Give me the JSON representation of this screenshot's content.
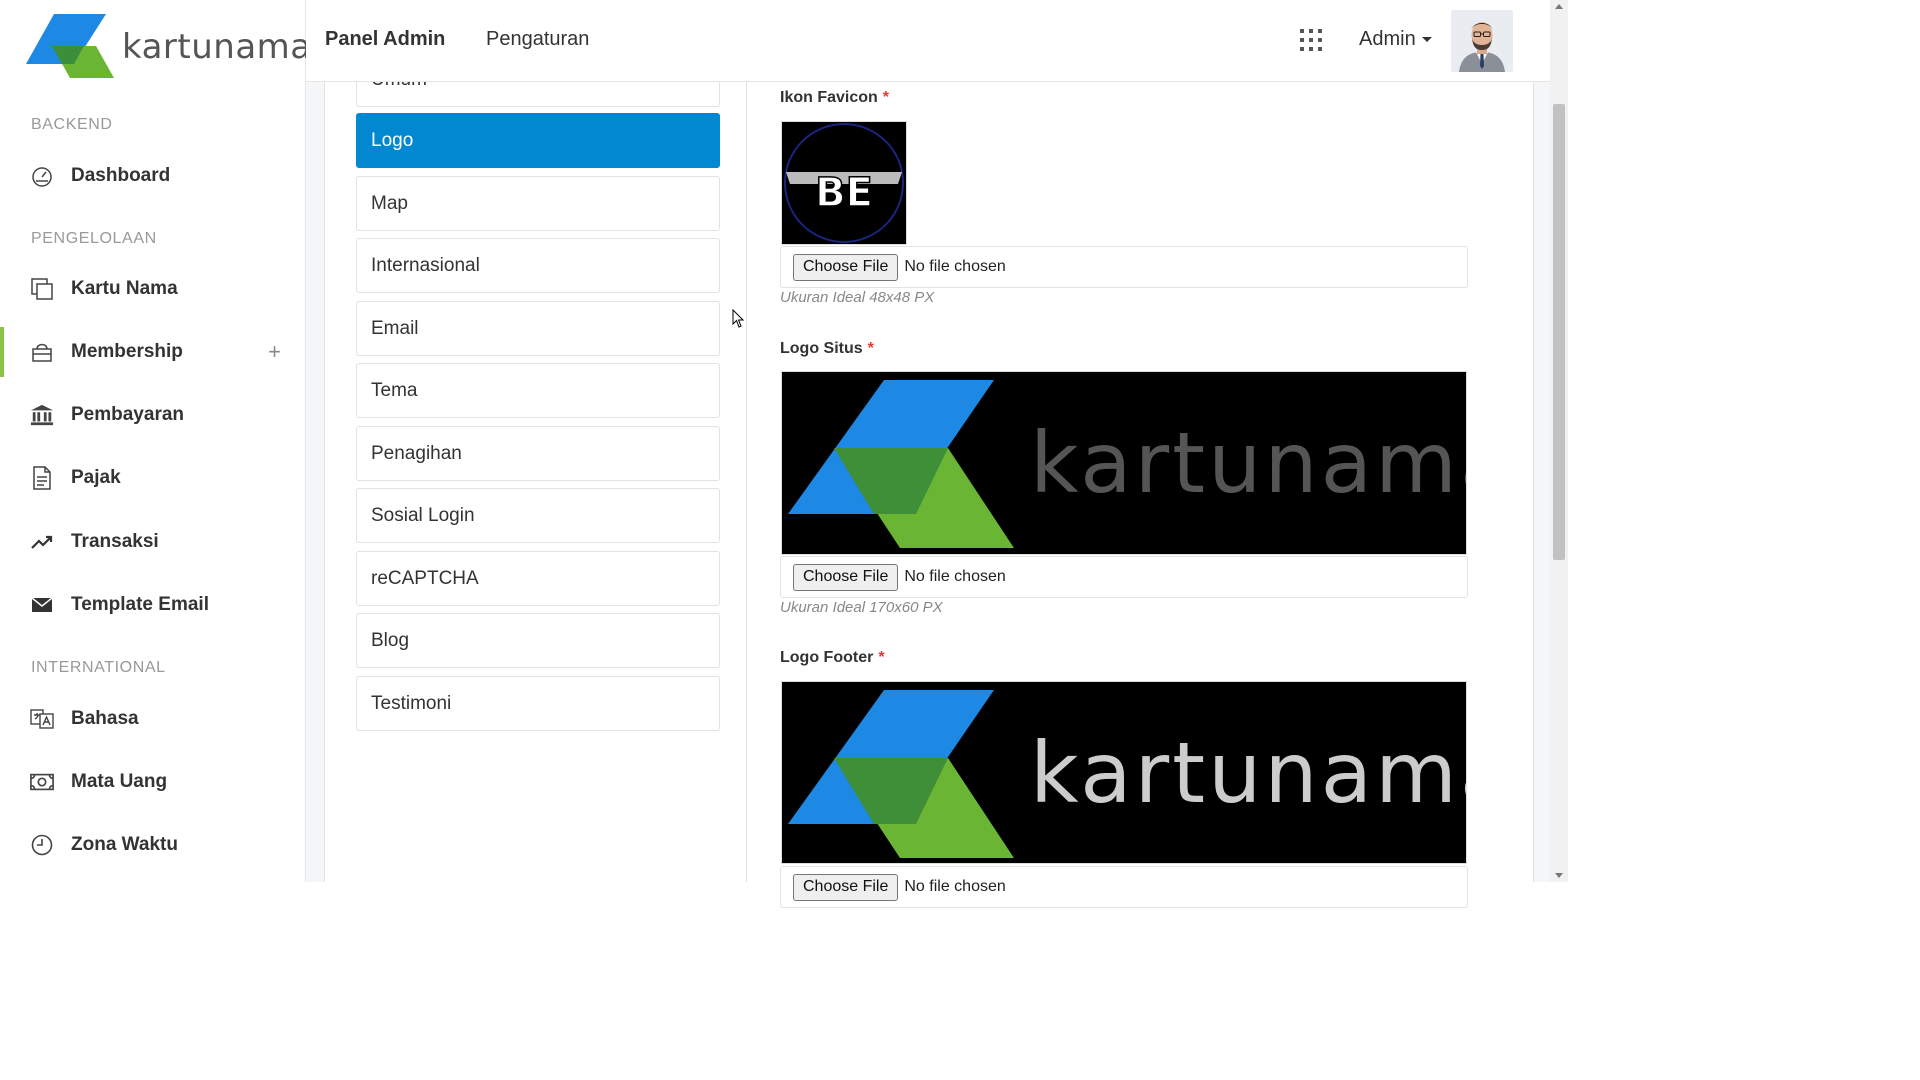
{
  "brand": {
    "name": "kartunama"
  },
  "topbar": {
    "links": [
      "Panel Admin",
      "Pengaturan"
    ],
    "apps_icon": "grid-icon",
    "user_label": "Admin"
  },
  "sidebar": {
    "sections": {
      "backend": "BACKEND",
      "pengelolaan": "PENGELOLAAN",
      "international": "INTERNATIONAL"
    },
    "items": [
      {
        "label": "Dashboard",
        "icon": "dashboard-icon"
      },
      {
        "label": "Kartu Nama",
        "icon": "cards-icon"
      },
      {
        "label": "Membership",
        "icon": "bag-icon",
        "expand": "+"
      },
      {
        "label": "Pembayaran",
        "icon": "bank-icon"
      },
      {
        "label": "Pajak",
        "icon": "document-icon"
      },
      {
        "label": "Transaksi",
        "icon": "trend-icon"
      },
      {
        "label": "Template Email",
        "icon": "envelope-icon"
      },
      {
        "label": "Bahasa",
        "icon": "translate-icon"
      },
      {
        "label": "Mata Uang",
        "icon": "money-icon"
      },
      {
        "label": "Zona Waktu",
        "icon": "clock-icon"
      }
    ]
  },
  "settings_menu": {
    "partial_top": "Umum",
    "items": [
      "Logo",
      "Map",
      "Internasional",
      "Email",
      "Tema",
      "Penagihan",
      "Sosial Login",
      "reCAPTCHA",
      "Blog",
      "Testimoni"
    ],
    "active": "Logo"
  },
  "form": {
    "favicon": {
      "label": "Ikon Favicon",
      "required": "*",
      "button": "Choose File",
      "status": "No file chosen",
      "hint": "Ukuran Ideal 48x48 PX",
      "preview_text": "BE"
    },
    "logo_site": {
      "label": "Logo Situs",
      "required": "*",
      "button": "Choose File",
      "status": "No file chosen",
      "hint": "Ukuran Ideal 170x60 PX",
      "preview_text": "kartunama"
    },
    "logo_footer": {
      "label": "Logo Footer",
      "required": "*",
      "button": "Choose File",
      "status": "No file chosen",
      "preview_text": "kartunama"
    }
  },
  "colors": {
    "accent_blue": "#0288d1",
    "active_bar": "#8bc34a",
    "required": "#e53935",
    "logo_blue": "#1e88e5",
    "logo_green": "#6ab534"
  }
}
